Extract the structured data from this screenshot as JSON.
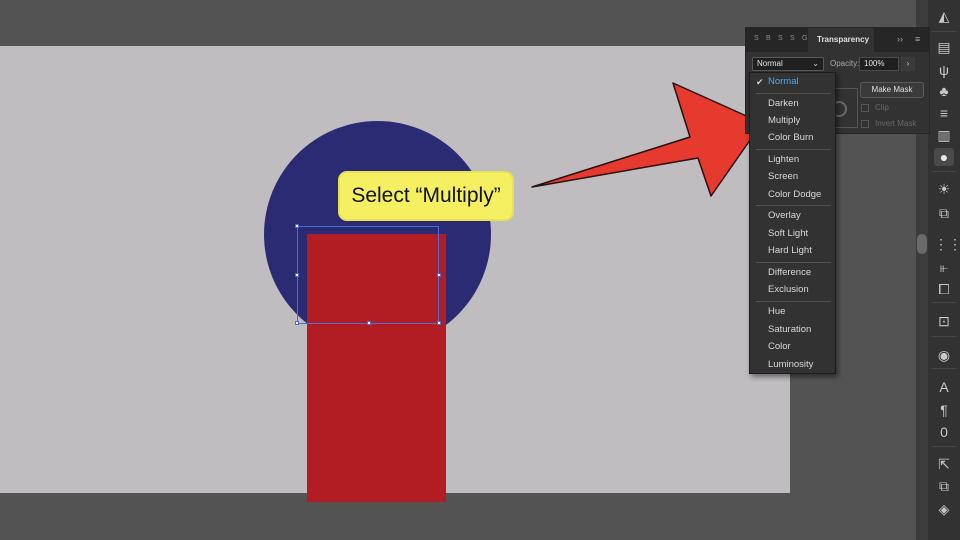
{
  "callout": {
    "text": "Select “Multiply”"
  },
  "panel": {
    "tabs": [
      "S",
      "B",
      "S",
      "S",
      "G"
    ],
    "active_tab": "Transparency",
    "forward_label": "››",
    "blend_mode": {
      "value": "Normal",
      "chevron": "⌄"
    },
    "opacity": {
      "label": "Opacity:",
      "value": "100%",
      "arrow": "›"
    },
    "mask_button": "Make Mask",
    "clip_label": "Clip",
    "invert_mask_label": "Invert Mask"
  },
  "menu": {
    "check": "✔",
    "items": [
      {
        "label": "Normal",
        "selected": true
      },
      {
        "label": "Darken"
      },
      {
        "label": "Multiply"
      },
      {
        "label": "Color Burn"
      },
      {
        "label": "Lighten"
      },
      {
        "label": "Screen"
      },
      {
        "label": "Color Dodge"
      },
      {
        "label": "Overlay"
      },
      {
        "label": "Soft Light"
      },
      {
        "label": "Hard Light"
      },
      {
        "label": "Difference"
      },
      {
        "label": "Exclusion"
      },
      {
        "label": "Hue"
      },
      {
        "label": "Saturation"
      },
      {
        "label": "Color"
      },
      {
        "label": "Luminosity"
      }
    ]
  },
  "toolbar": {
    "icons": [
      "gradient-icon",
      "libraries-icon",
      "brushes-icon",
      "symbols-icon",
      "stroke-icon",
      "gradient-swatch-icon",
      "transparency-icon",
      "appearance-icon",
      "graphic-styles-icon",
      "transform-icon",
      "align-icon",
      "pathfinder-icon",
      "artboards-icon",
      "color-guide-icon",
      "character-icon",
      "paragraph-icon",
      "opentype-icon",
      "export-icon",
      "links-icon",
      "layers-icon"
    ]
  },
  "colors": {
    "circle": "#2a2b72",
    "rectangle": "#b11d23",
    "artboard": "#bfbdbf",
    "callout": "#f5ef62",
    "arrow": "#e53a2d",
    "menu_selected": "#4aa8f3"
  }
}
